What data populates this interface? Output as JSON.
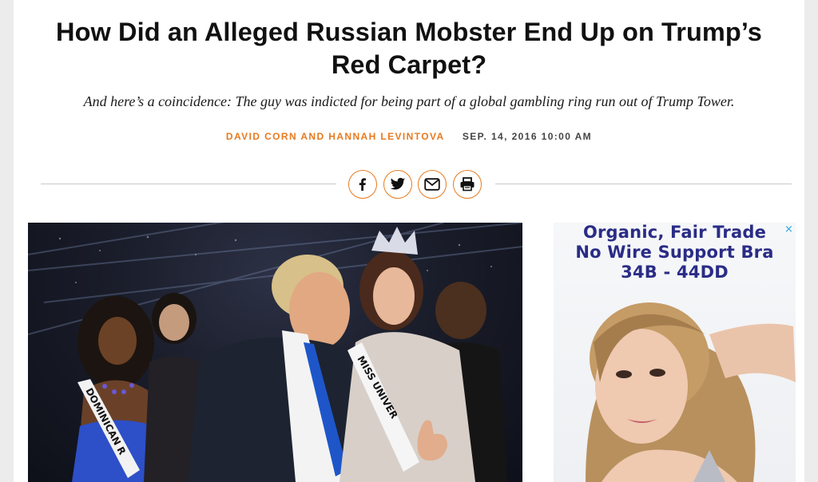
{
  "article": {
    "headline_line1": "How Did an Alleged Russian Mobster End Up on Trump’s",
    "headline_line2": "Red Carpet?",
    "dek": "And here’s a coincidence: The guy was indicted for being part of a global gambling ring run out of Trump Tower.",
    "authors": "DAVID CORN AND HANNAH LEVINTOVA",
    "date": "SEP. 14, 2016 10:00 AM"
  },
  "share": [
    {
      "icon": "facebook-icon"
    },
    {
      "icon": "twitter-icon"
    },
    {
      "icon": "email-icon"
    },
    {
      "icon": "print-icon"
    }
  ],
  "photo": {
    "sash_left": "DOMINICAN R",
    "sash_right": "MISS UNIVER"
  },
  "ad": {
    "line1": "Organic, Fair Trade",
    "line2": "No Wire Support Bra",
    "line3": "34B - 44DD",
    "close": "×"
  },
  "colors": {
    "accent": "#e77a1f",
    "ad_text": "#2a2c86",
    "ad_close": "#29a7df"
  }
}
